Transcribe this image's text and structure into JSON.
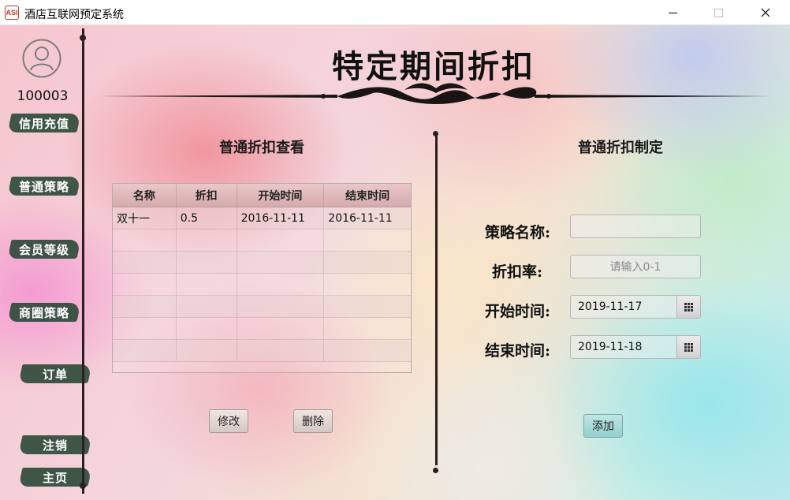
{
  "window": {
    "app_icon_text": "ASI",
    "title": "酒店互联网预定系统",
    "close_glyph": "✕"
  },
  "sidebar": {
    "user_id": "100003",
    "items": [
      {
        "label": "信用充值"
      },
      {
        "label": "普通策略"
      },
      {
        "label": "会员等级"
      },
      {
        "label": "商圈策略"
      },
      {
        "label": "订单"
      },
      {
        "label": "注销"
      },
      {
        "label": "主页"
      }
    ]
  },
  "page": {
    "title": "特定期间折扣"
  },
  "left_panel": {
    "title": "普通折扣查看",
    "table": {
      "columns": [
        "名称",
        "折扣",
        "开始时间",
        "结束时间"
      ],
      "rows": [
        [
          "双十一",
          "0.5",
          "2016-11-11",
          "2016-11-11"
        ]
      ]
    },
    "edit_label": "修改",
    "delete_label": "删除"
  },
  "right_panel": {
    "title": "普通折扣制定",
    "name_label": "策略名称:",
    "name_value": "",
    "rate_label": "折扣率:",
    "rate_placeholder": "请输入0-1",
    "start_label": "开始时间:",
    "start_value": "2019-11-17",
    "end_label": "结束时间:",
    "end_value": "2019-11-18",
    "add_label": "添加"
  },
  "colors": {
    "sidebar_button": "#2f4b3a",
    "divider": "#2a1f1f",
    "add_button": "#92cfcc"
  }
}
